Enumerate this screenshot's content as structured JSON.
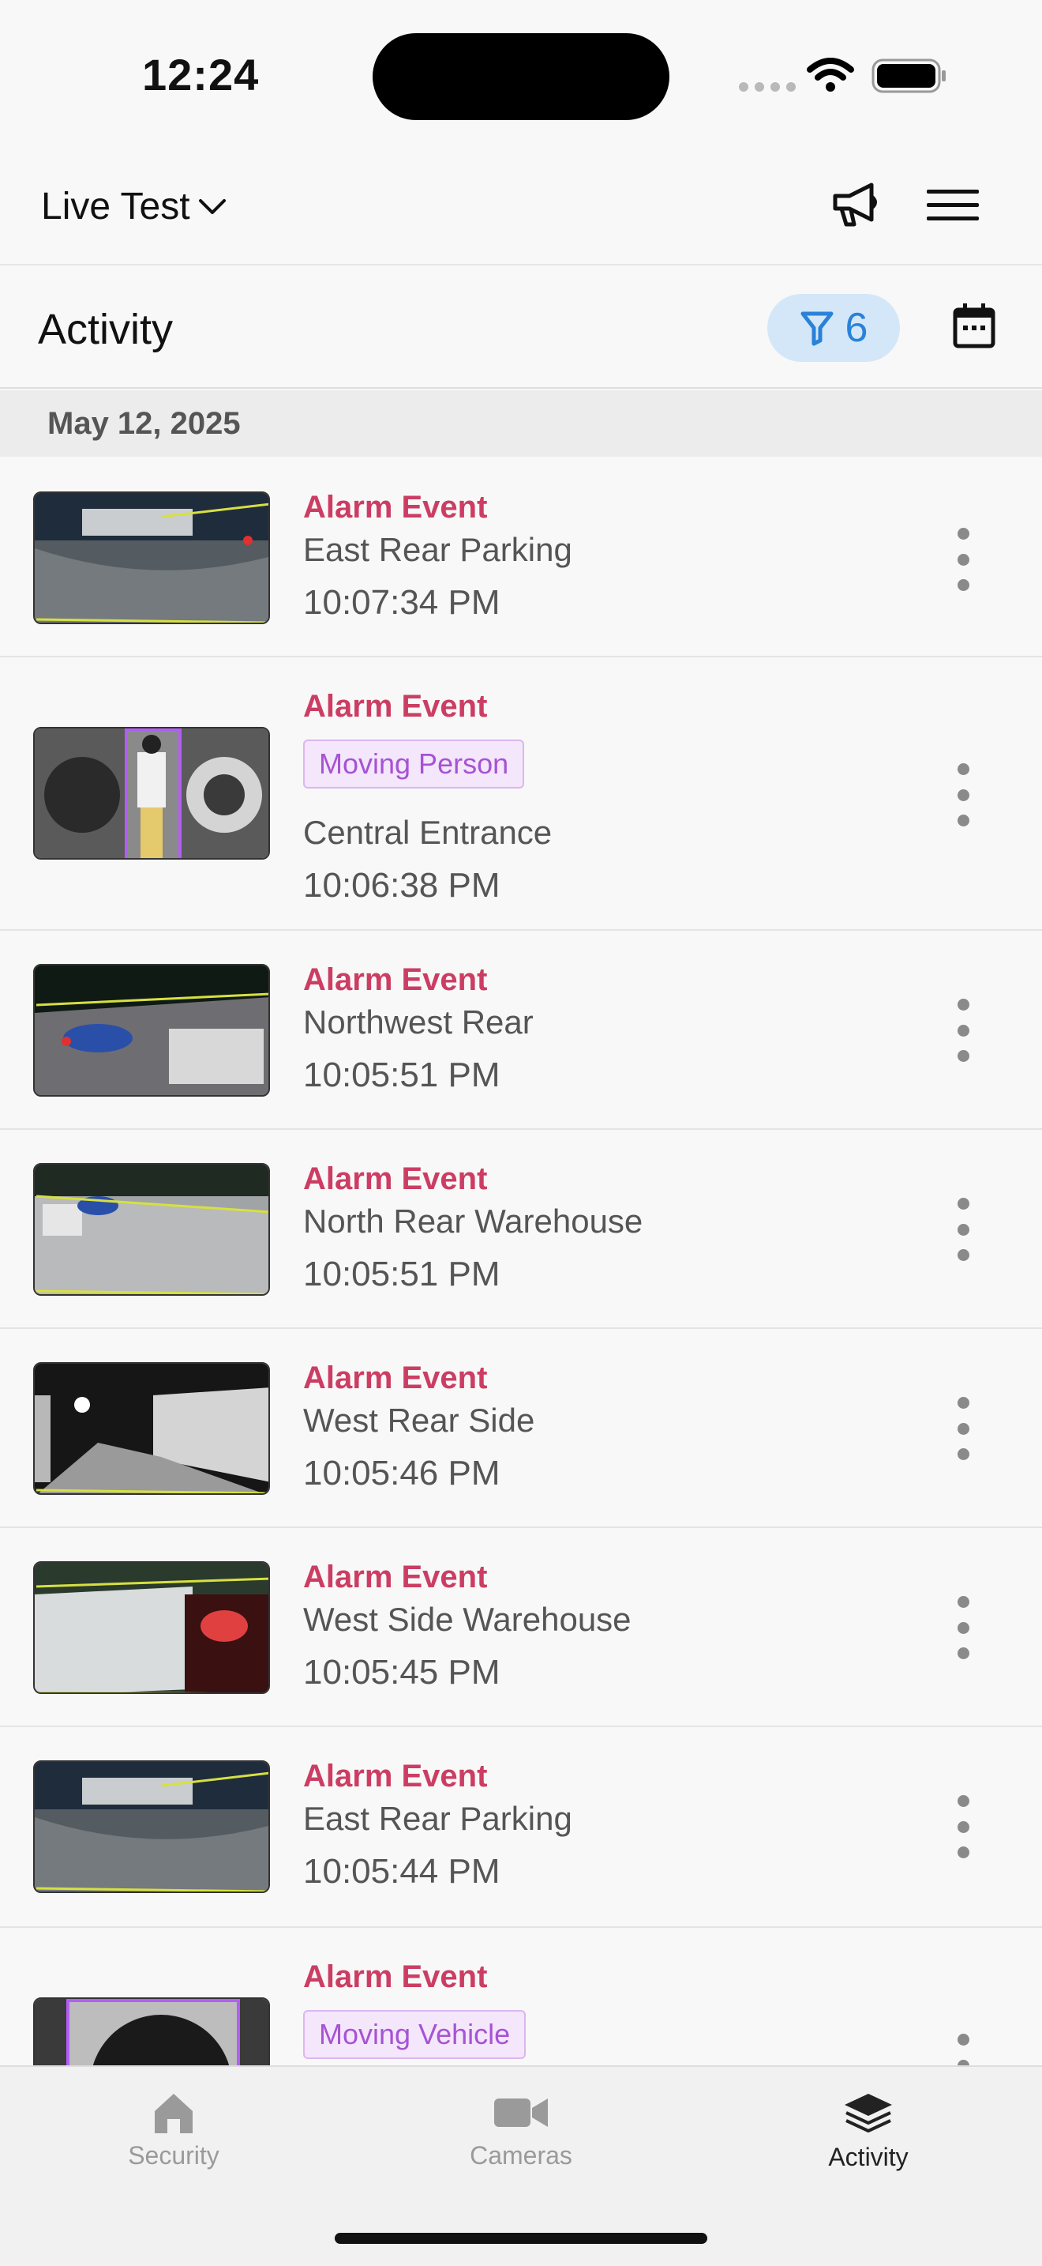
{
  "status_bar": {
    "time": "12:24"
  },
  "header": {
    "site_name": "Live Test"
  },
  "activity_bar": {
    "title": "Activity",
    "filter_count": "6"
  },
  "date_header": "May 12, 2025",
  "events": [
    {
      "type": "Alarm Event",
      "location": "East Rear Parking",
      "time": "10:07:34 PM"
    },
    {
      "type": "Alarm Event",
      "badge": "Moving Person",
      "location": "Central Entrance",
      "time": "10:06:38 PM"
    },
    {
      "type": "Alarm Event",
      "location": "Northwest Rear",
      "time": "10:05:51 PM"
    },
    {
      "type": "Alarm Event",
      "location": "North Rear Warehouse",
      "time": "10:05:51 PM"
    },
    {
      "type": "Alarm Event",
      "location": "West Rear Side",
      "time": "10:05:46 PM"
    },
    {
      "type": "Alarm Event",
      "location": "West Side Warehouse",
      "time": "10:05:45 PM"
    },
    {
      "type": "Alarm Event",
      "location": "East Rear Parking",
      "time": "10:05:44 PM"
    },
    {
      "type": "Alarm Event",
      "badge": "Moving Vehicle"
    }
  ],
  "tabs": [
    {
      "label": "Security",
      "icon": "house-icon"
    },
    {
      "label": "Cameras",
      "icon": "video-camera-icon"
    },
    {
      "label": "Activity",
      "icon": "layers-icon",
      "active": true
    }
  ],
  "colors": {
    "event_type": "#cc3d63",
    "badge_text": "#a653d4",
    "filter_accent": "#2a82d8"
  }
}
